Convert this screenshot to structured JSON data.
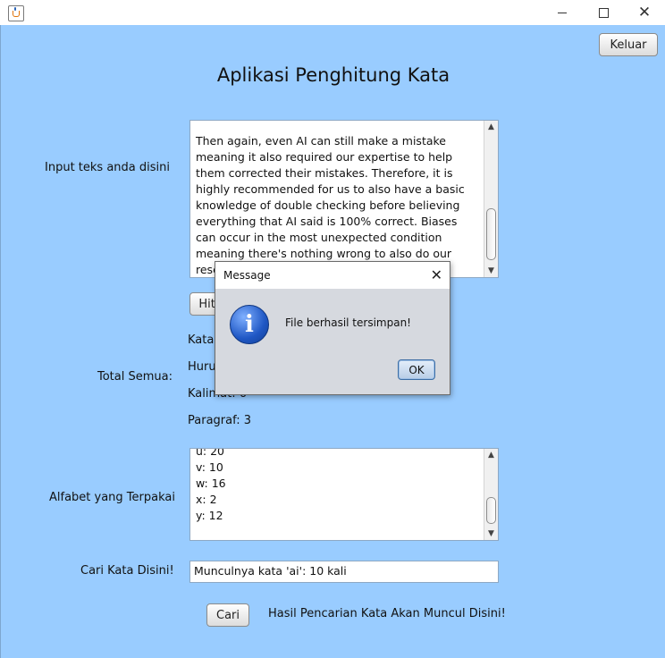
{
  "window": {
    "close_glyph": "✕"
  },
  "header": {
    "exit_button": "Keluar",
    "title": "Aplikasi Penghitung Kata"
  },
  "input": {
    "label": "Input teks anda disini",
    "lines": [
      "Then again, even AI can still make a mistake",
      "meaning it also required our expertise to help",
      "them corrected their mistakes. Therefore, it is",
      "highly recommended for us to also have a basic",
      "knowledge of double checking before believing",
      "everything that AI said is 100% correct. Biases",
      "can occur in the most unexpected condition",
      "meaning there's nothing wrong to also do our",
      "research"
    ],
    "count_button": "Hitung"
  },
  "totals": {
    "label": "Total Semua:",
    "words_label": "Kata:",
    "letters_label": "Huruf:",
    "sentences_label": "Kalimat: 6",
    "paragraphs_label": "Paragraf: 3"
  },
  "alphabet": {
    "label": "Alfabet yang Terpakai",
    "lines": [
      "u: 20",
      "v: 10",
      "w: 16",
      "x: 2",
      "y: 12"
    ]
  },
  "search": {
    "label": "Cari Kata Disini!",
    "value": "Munculnya kata 'ai': 10 kali",
    "button": "Cari",
    "result_text": "Hasil Pencarian Kata Akan Muncul Disini!"
  },
  "dialog": {
    "title": "Message",
    "message": "File berhasil tersimpan!",
    "ok_button": "OK",
    "icon": "info-icon",
    "icon_glyph": "i"
  },
  "colors": {
    "background": "#99ccff"
  }
}
